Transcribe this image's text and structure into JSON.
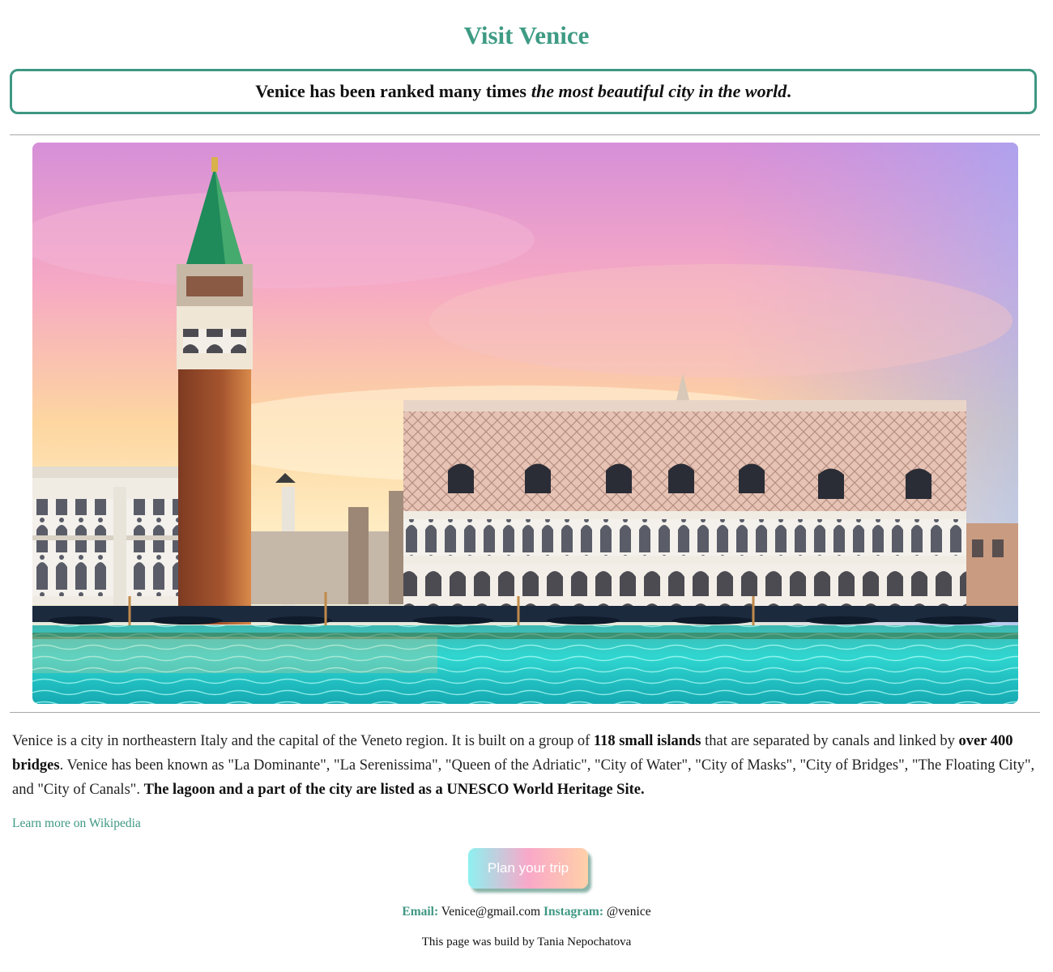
{
  "header": {
    "title": "Visit Venice"
  },
  "quote": {
    "text_plain": "Venice has been ranked many times",
    "text_emphasis": "the most beautiful city in the world",
    "text_end": "."
  },
  "hero_image": {
    "subject": "Doge's Palace and St Mark's Campanile at sunset",
    "icon": "venice-photo"
  },
  "intro": {
    "p1": "Venice is a city in northeastern Italy and the capital of the Veneto region. It is built on a group of ",
    "b1": "118 small islands",
    "p2": " that are separated by canals and linked by ",
    "b2": "over 400 bridges",
    "p3": ". Venice has been known as \"La Dominante\", \"La Serenissima\", \"Queen of the Adriatic\", \"City of Water\", \"City of Masks\", \"City of Bridges\", \"The Floating City\", and \"City of Canals\". ",
    "b3": "The lagoon and a part of the city are listed as a UNESCO World Heritage Site."
  },
  "links": {
    "wikipedia_label": "Learn more on Wikipedia"
  },
  "cta": {
    "label": "Plan your trip"
  },
  "contact": {
    "email_label": "Email:",
    "email_value": "Venice@gmail.com",
    "instagram_label": "Instagram:",
    "instagram_value": "@venice"
  },
  "footer": {
    "credit": "This page was build by Tania Nepochatova"
  },
  "colors": {
    "accent": "#3e9b84",
    "border": "#3e9783",
    "button_gradient": [
      "#8ef0f0",
      "#f9a8c9",
      "#ffd0a8"
    ]
  }
}
